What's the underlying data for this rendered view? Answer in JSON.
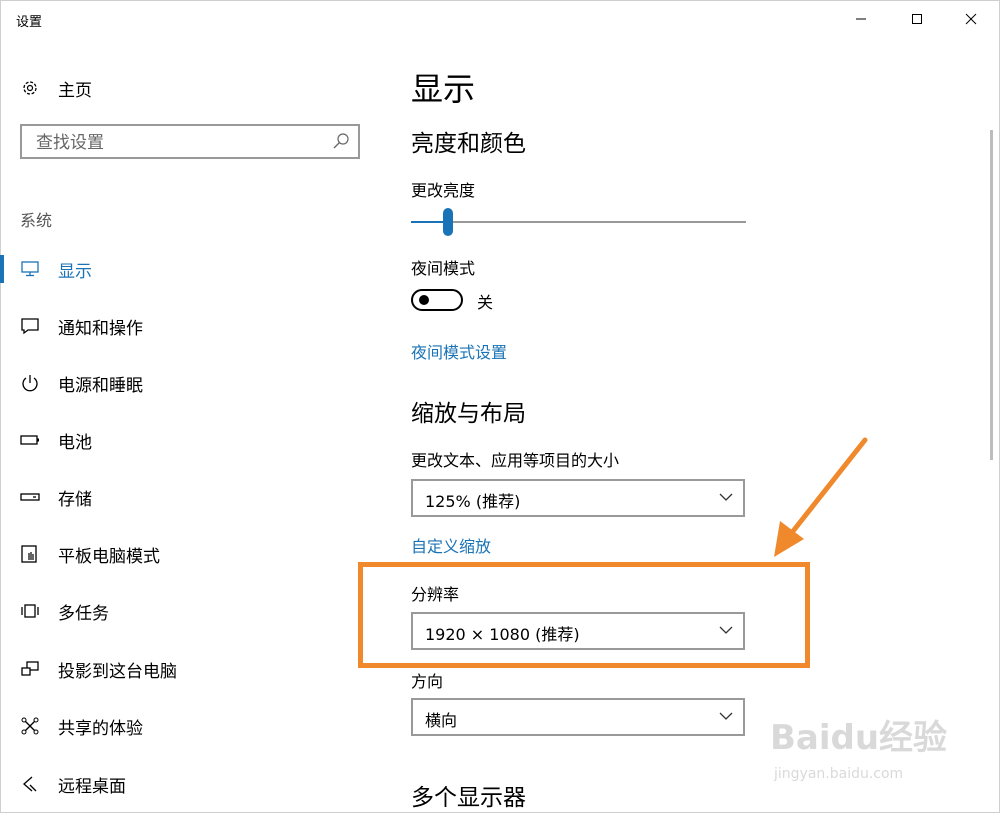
{
  "window": {
    "title": "设置"
  },
  "sidebar": {
    "home_label": "主页",
    "search_placeholder": "查找设置",
    "group_label": "系统",
    "items": [
      {
        "label": "显示",
        "icon": "monitor-icon",
        "active": true
      },
      {
        "label": "通知和操作",
        "icon": "message-icon"
      },
      {
        "label": "电源和睡眠",
        "icon": "power-icon"
      },
      {
        "label": "电池",
        "icon": "battery-icon"
      },
      {
        "label": "存储",
        "icon": "storage-icon"
      },
      {
        "label": "平板电脑模式",
        "icon": "tablet-icon"
      },
      {
        "label": "多任务",
        "icon": "multitask-icon"
      },
      {
        "label": "投影到这台电脑",
        "icon": "project-icon"
      },
      {
        "label": "共享的体验",
        "icon": "share-icon"
      },
      {
        "label": "远程桌面",
        "icon": "remote-icon"
      }
    ]
  },
  "main": {
    "title": "显示",
    "brightness_section": "亮度和颜色",
    "brightness_label": "更改亮度",
    "brightness_level": 0.11,
    "night_label": "夜间模式",
    "night_state": "关",
    "night_link": "夜间模式设置",
    "scale_section": "缩放与布局",
    "scale_label": "更改文本、应用等项目的大小",
    "scale_value": "125% (推荐)",
    "custom_scale_link": "自定义缩放",
    "resolution_label": "分辨率",
    "resolution_value": "1920 × 1080 (推荐)",
    "orientation_label": "方向",
    "orientation_value": "横向",
    "multi_display_section": "多个显示器"
  },
  "watermark": {
    "logo": "Baidu经验",
    "url": "jingyan.baidu.com"
  },
  "colors": {
    "accent": "#1a73b6",
    "highlight": "#f0882c"
  }
}
